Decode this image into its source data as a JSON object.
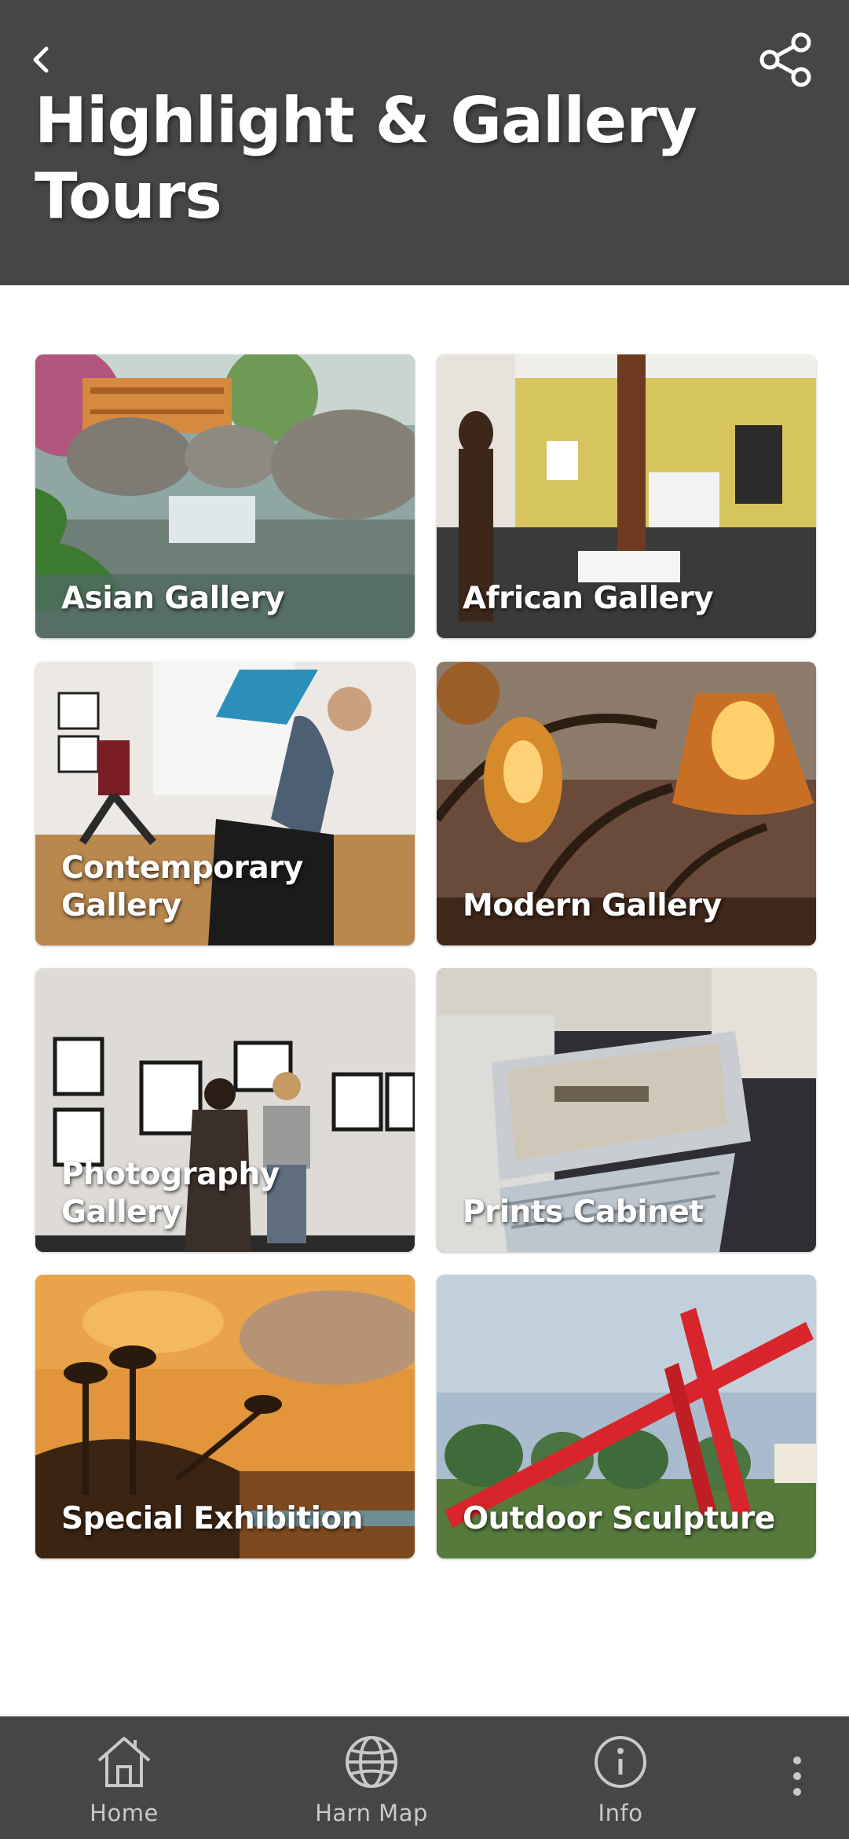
{
  "header": {
    "title": "Highlight & Gallery Tours",
    "back_icon": "chevron-left-icon",
    "share_icon": "share-icon",
    "background": "#464646"
  },
  "tiles": [
    {
      "label": "Asian Gallery",
      "scene": "asian-garden"
    },
    {
      "label": "African Gallery",
      "scene": "african-hall"
    },
    {
      "label": "Contemporary Gallery",
      "scene": "contemporary-dance"
    },
    {
      "label": "Modern Gallery",
      "scene": "modern-lamps"
    },
    {
      "label": "Photography Gallery",
      "scene": "photography-wall"
    },
    {
      "label": "Prints Cabinet",
      "scene": "prints-drawer"
    },
    {
      "label": "Special Exhibition",
      "scene": "special-sunset"
    },
    {
      "label": "Outdoor Sculpture",
      "scene": "outdoor-red-sculpture"
    }
  ],
  "bottom_nav": {
    "items": [
      {
        "label": "Home",
        "icon": "home-icon"
      },
      {
        "label": "Harn Map",
        "icon": "globe-icon"
      },
      {
        "label": "Info",
        "icon": "info-icon"
      }
    ],
    "more_icon": "more-vertical-icon"
  }
}
